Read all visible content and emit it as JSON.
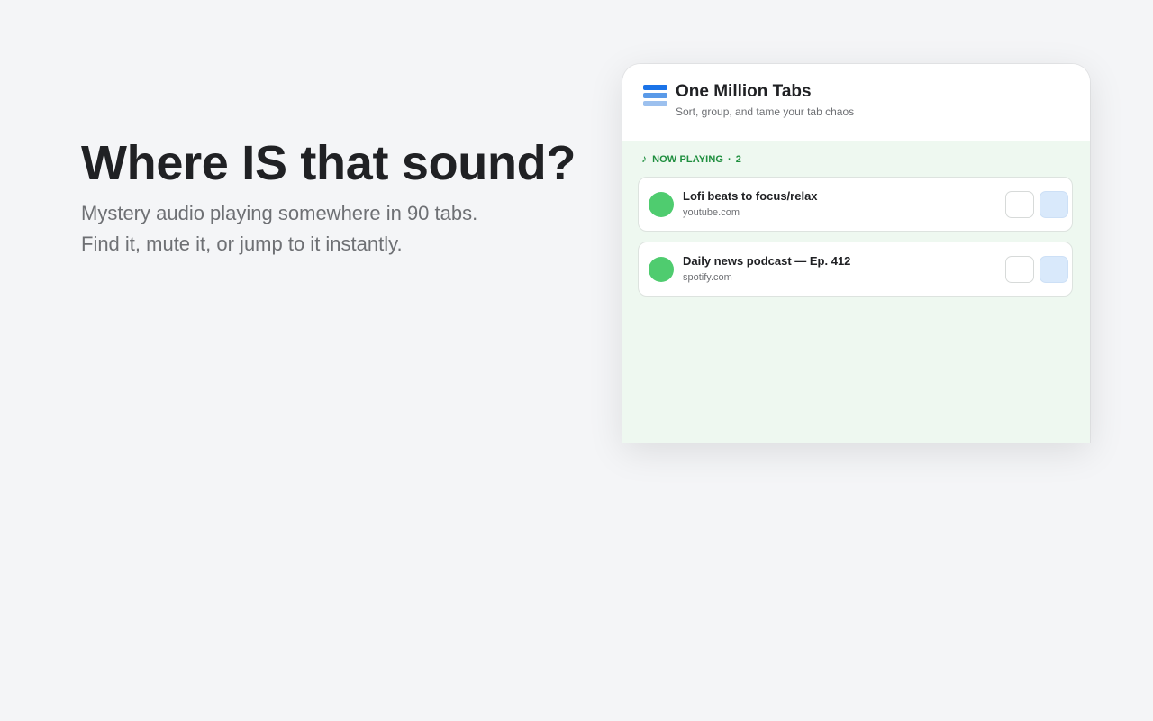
{
  "hero": {
    "headline": "Where IS that sound?",
    "sub_line1": "Mystery audio playing somewhere in 90 tabs.",
    "sub_line2": "Find it, mute it, or jump to it instantly."
  },
  "app": {
    "name": "One Million Tabs",
    "tagline": "Sort, group, and tame your tab chaos",
    "logo_icon": "stacked-tabs-icon",
    "accent_color": "#1a73e8"
  },
  "now_playing": {
    "label": "NOW PLAYING",
    "separator": "·",
    "count": "2",
    "note_icon": "♪",
    "color": "#1e8e3e",
    "tabs": [
      {
        "title": "Lofi beats to focus/relax",
        "domain": "youtube.com",
        "favicon_color": "#4fcc6f",
        "mute_icon": "",
        "jump_icon": ""
      },
      {
        "title": "Daily news podcast — Ep. 412",
        "domain": "spotify.com",
        "favicon_color": "#4fcc6f",
        "mute_icon": "",
        "jump_icon": ""
      }
    ]
  }
}
